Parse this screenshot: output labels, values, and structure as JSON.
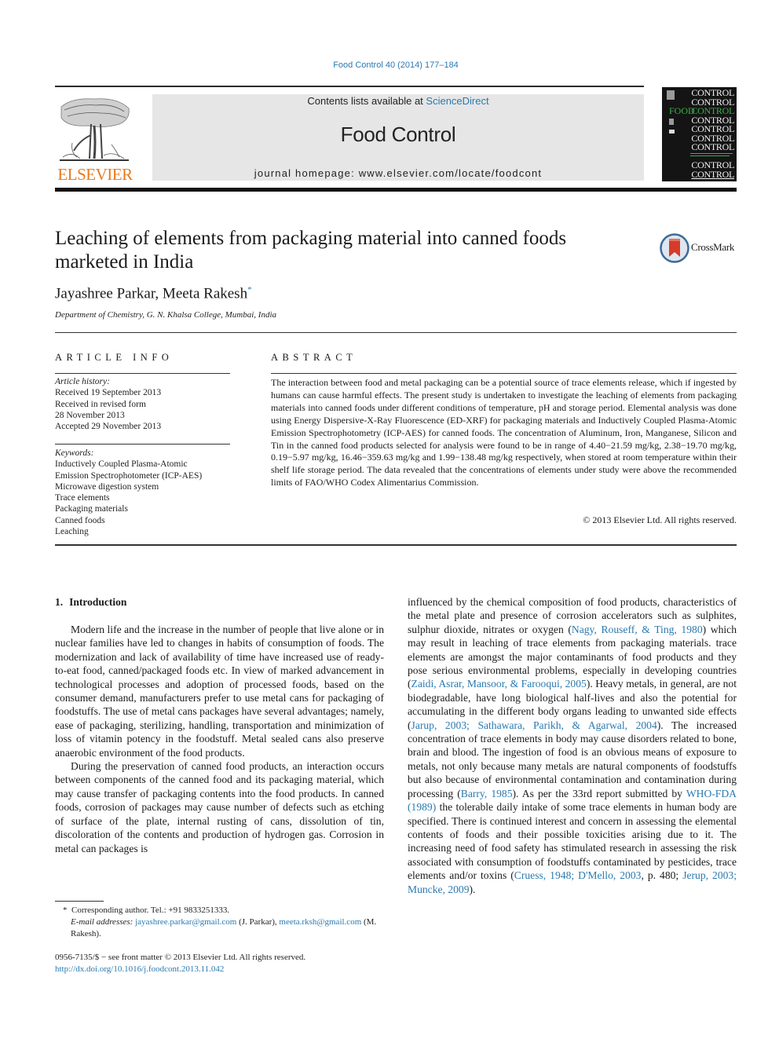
{
  "header": {
    "citation": "Food Control 40 (2014) 177–184",
    "contents_prefix": "Contents lists available at ",
    "contents_link": "ScienceDirect",
    "journal_title": "Food Control",
    "homepage_prefix": "journal homepage: ",
    "homepage_url": "www.elsevier.com/locate/foodcont",
    "publisher_logo_text": "ELSEVIER",
    "cover": {
      "word": "CONTROL",
      "food_word": "FOOD"
    },
    "crossmark_label": "CrossMark"
  },
  "article": {
    "title_line1": "Leaching of elements from packaging material into canned foods",
    "title_line2": "marketed in India",
    "authors": "Jayashree Parkar, Meeta Rakesh",
    "corresponding_mark": "*",
    "affiliation": "Department of Chemistry, G. N. Khalsa College, Mumbai, India"
  },
  "article_info": {
    "heading": "ARTICLE INFO",
    "history_label": "Article history:",
    "history": [
      "Received 19 September 2013",
      "Received in revised form",
      "28 November 2013",
      "Accepted 29 November 2013"
    ],
    "keywords_label": "Keywords:",
    "keywords": [
      "Inductively Coupled Plasma-Atomic",
      "Emission Spectrophotometer (ICP-AES)",
      "Microwave digestion system",
      "Trace elements",
      "Packaging materials",
      "Canned foods",
      "Leaching"
    ]
  },
  "abstract": {
    "heading": "ABSTRACT",
    "text": "The interaction between food and metal packaging can be a potential source of trace elements release, which if ingested by humans can cause harmful effects. The present study is undertaken to investigate the leaching of elements from packaging materials into canned foods under different conditions of temperature, pH and storage period. Elemental analysis was done using Energy Dispersive-X-Ray Fluorescence (ED-XRF) for packaging materials and Inductively Coupled Plasma-Atomic Emission Spectrophotometry (ICP-AES) for canned foods. The concentration of Aluminum, Iron, Manganese, Silicon and Tin in the canned food products selected for analysis were found to be in range of 4.40−21.59 mg/kg, 2.38−19.70 mg/kg, 0.19−5.97 mg/kg, 16.46−359.63 mg/kg and 1.99−138.48 mg/kg respectively, when stored at room temperature within their shelf life storage period. The data revealed that the concentrations of elements under study were above the recommended limits of FAO/WHO Codex Alimentarius Commission.",
    "copyright": "© 2013 Elsevier Ltd. All rights reserved."
  },
  "body": {
    "section_number": "1.",
    "section_title": "Introduction",
    "left_p1": "Modern life and the increase in the number of people that live alone or in nuclear families have led to changes in habits of consumption of foods. The modernization and lack of availability of time have increased use of ready-to-eat food, canned/packaged foods etc. In view of marked advancement in technological processes and adoption of processed foods, based on the consumer demand, manufacturers prefer to use metal cans for packaging of foodstuffs. The use of metal cans packages have several advantages; namely, ease of packaging, sterilizing, handling, transportation and minimization of loss of vitamin potency in the foodstuff. Metal sealed cans also preserve anaerobic environment of the food products.",
    "left_p2": "During the preservation of canned food products, an interaction occurs between components of the canned food and its packaging material, which may cause transfer of packaging contents into the food products. In canned foods, corrosion of packages may cause number of defects such as etching of surface of the plate, internal rusting of cans, dissolution of tin, discoloration of the contents and production of hydrogen gas. Corrosion in metal can packages is",
    "right": {
      "t1": "influenced by the chemical composition of food products, characteristics of the metal plate and presence of corrosion accelerators such as sulphites, sulphur dioxide, nitrates or oxygen (",
      "ref1": "Nagy, Rouseff, & Ting, 1980",
      "t2": ") which may result in leaching of trace elements from packaging materials. trace elements are amongst the major contaminants of food products and they pose serious environmental problems, especially in developing countries (",
      "ref2": "Zaidi, Asrar, Mansoor, & Farooqui, 2005",
      "t3": "). Heavy metals, in general, are not biodegradable, have long biological half-lives and also the potential for accumulating in the different body organs leading to unwanted side effects (",
      "ref3": "Jarup, 2003; Sathawara, Parikh, & Agarwal, 2004",
      "t4": "). The increased concentration of trace elements in body may cause disorders related to bone, brain and blood. The ingestion of food is an obvious means of exposure to metals, not only because many metals are natural components of foodstuffs but also because of environmental contamination and contamination during processing (",
      "ref4": "Barry, 1985",
      "t5": "). As per the 33rd report submitted by ",
      "ref5": "WHO-FDA (1989)",
      "t6": " the tolerable daily intake of some trace elements in human body are specified. There is continued interest and concern in assessing the elemental contents of foods and their possible toxicities arising due to it. The increasing need of food safety has stimulated research in assessing the risk associated with consumption of foodstuffs contaminated by pesticides, trace elements and/or toxins (",
      "ref6": "Cruess, 1948; D'Mello, 2003",
      "t7": ", p. 480; ",
      "ref7": "Jerup, 2003; Muncke, 2009",
      "t8": ")."
    }
  },
  "footnote": {
    "mark": "*",
    "corresponding": "Corresponding author. Tel.: +91 9833251333.",
    "email_label": "E-mail addresses:",
    "email1": "jayashree.parkar@gmail.com",
    "email1_owner": " (J. Parkar), ",
    "email2": "meeta.rksh@gmail.com",
    "email2_owner": " (M. Rakesh)."
  },
  "front_matter": {
    "issn_line": "0956-7135/$ − see front matter © 2013 Elsevier Ltd. All rights reserved.",
    "doi": "http://dx.doi.org/10.1016/j.foodcont.2013.11.042"
  }
}
